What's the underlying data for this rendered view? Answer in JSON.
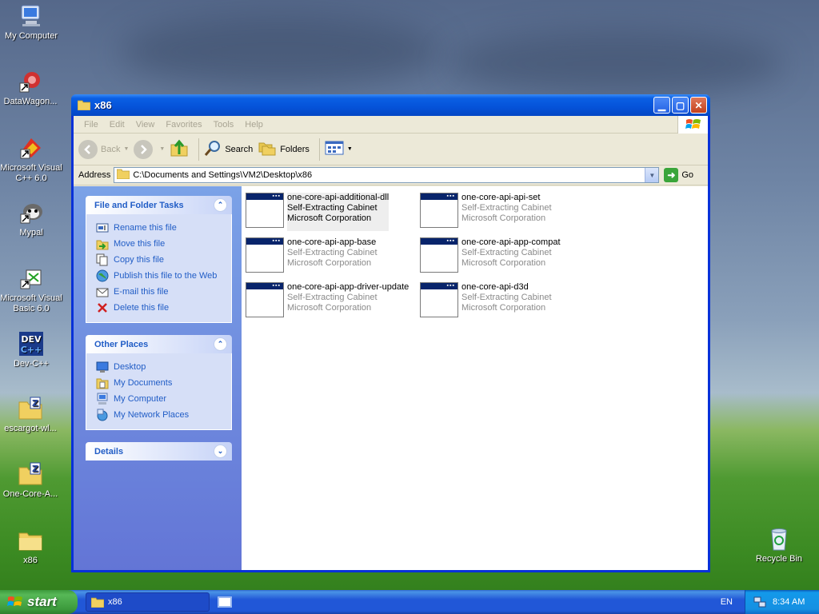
{
  "desktop": {
    "icons": [
      {
        "label": "My Computer"
      },
      {
        "label": "DataWagon..."
      },
      {
        "label": "Microsoft Visual C++ 6.0"
      },
      {
        "label": "Mypal"
      },
      {
        "label": "Microsoft Visual Basic 6.0"
      },
      {
        "label": "Dev-C++"
      },
      {
        "label": "escargot-wl..."
      },
      {
        "label": "One-Core-A..."
      },
      {
        "label": "x86"
      },
      {
        "label": "Recycle Bin"
      }
    ]
  },
  "window": {
    "title": "x86",
    "menu": [
      "File",
      "Edit",
      "View",
      "Favorites",
      "Tools",
      "Help"
    ],
    "toolbar": {
      "back": "Back",
      "search": "Search",
      "folders": "Folders"
    },
    "address": {
      "label": "Address",
      "value": "C:\\Documents and Settings\\VM2\\Desktop\\x86",
      "go": "Go"
    },
    "tasks": {
      "file_folder": {
        "title": "File and Folder Tasks",
        "items": [
          "Rename this file",
          "Move this file",
          "Copy this file",
          "Publish this file to the Web",
          "E-mail this file",
          "Delete this file"
        ]
      },
      "other_places": {
        "title": "Other Places",
        "items": [
          "Desktop",
          "My Documents",
          "My Computer",
          "My Network Places"
        ]
      },
      "details": {
        "title": "Details"
      }
    },
    "files": [
      {
        "name": "one-core-api-additional-dll",
        "type": "Self-Extracting Cabinet",
        "company": "Microsoft Corporation"
      },
      {
        "name": "one-core-api-api-set",
        "type": "Self-Extracting Cabinet",
        "company": "Microsoft Corporation"
      },
      {
        "name": "one-core-api-app-base",
        "type": "Self-Extracting Cabinet",
        "company": "Microsoft Corporation"
      },
      {
        "name": "one-core-api-app-compat",
        "type": "Self-Extracting Cabinet",
        "company": "Microsoft Corporation"
      },
      {
        "name": "one-core-api-app-driver-update",
        "type": "Self-Extracting Cabinet",
        "company": "Microsoft Corporation"
      },
      {
        "name": "one-core-api-d3d",
        "type": "Self-Extracting Cabinet",
        "company": "Microsoft Corporation"
      }
    ]
  },
  "taskbar": {
    "start": "start",
    "task_button": "x86",
    "language": "EN",
    "clock": "8:34 AM"
  },
  "colors": {
    "xp_blue": "#0831d9",
    "task_link": "#215dc6",
    "start_green": "#3c9a3c"
  }
}
